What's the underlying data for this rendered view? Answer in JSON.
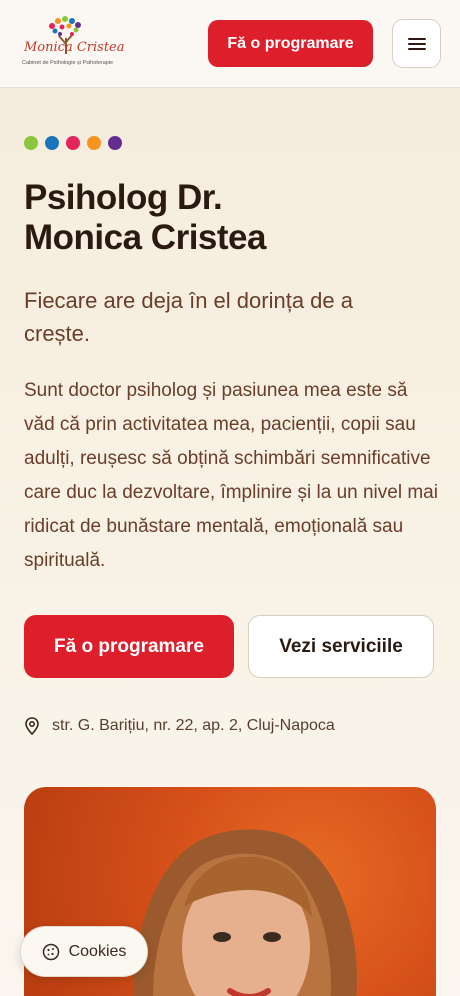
{
  "header": {
    "logo_name": "Monica Cristea",
    "logo_tagline": "Cabinet de Psihologie și Psihoterapie",
    "cta_label": "Fă o programare",
    "menu_icon": "hamburger-menu-icon"
  },
  "hero": {
    "dot_colors": [
      "#8cc63f",
      "#1b75bb",
      "#e5245c",
      "#f7941d",
      "#662d91"
    ],
    "title_line1": "Psiholog Dr.",
    "title_line2": "Monica Cristea",
    "subtitle": "Fiecare are deja în el dorința de a crește.",
    "description": "Sunt doctor psiholog și pasiunea mea este să văd că prin activitatea mea, pacienții, copii sau adulți, reușesc să obțină schimbări semnificative care duc la dezvoltare, împlinire și la un nivel mai ridicat de bunăstare mentală, emoțională sau spirituală.",
    "primary_cta": "Fă o programare",
    "secondary_cta": "Vezi serviciile",
    "address": "str. G. Barițiu, nr. 22, ap. 2, Cluj-Napoca",
    "address_icon": "location-pin-icon"
  },
  "cookies": {
    "label": "Cookies",
    "icon": "cookie-icon"
  },
  "colors": {
    "brand_red": "#dc1f2b",
    "text_dark": "#2a1a12",
    "text_brown": "#6a3e2a",
    "background": "#f8f3ea"
  }
}
